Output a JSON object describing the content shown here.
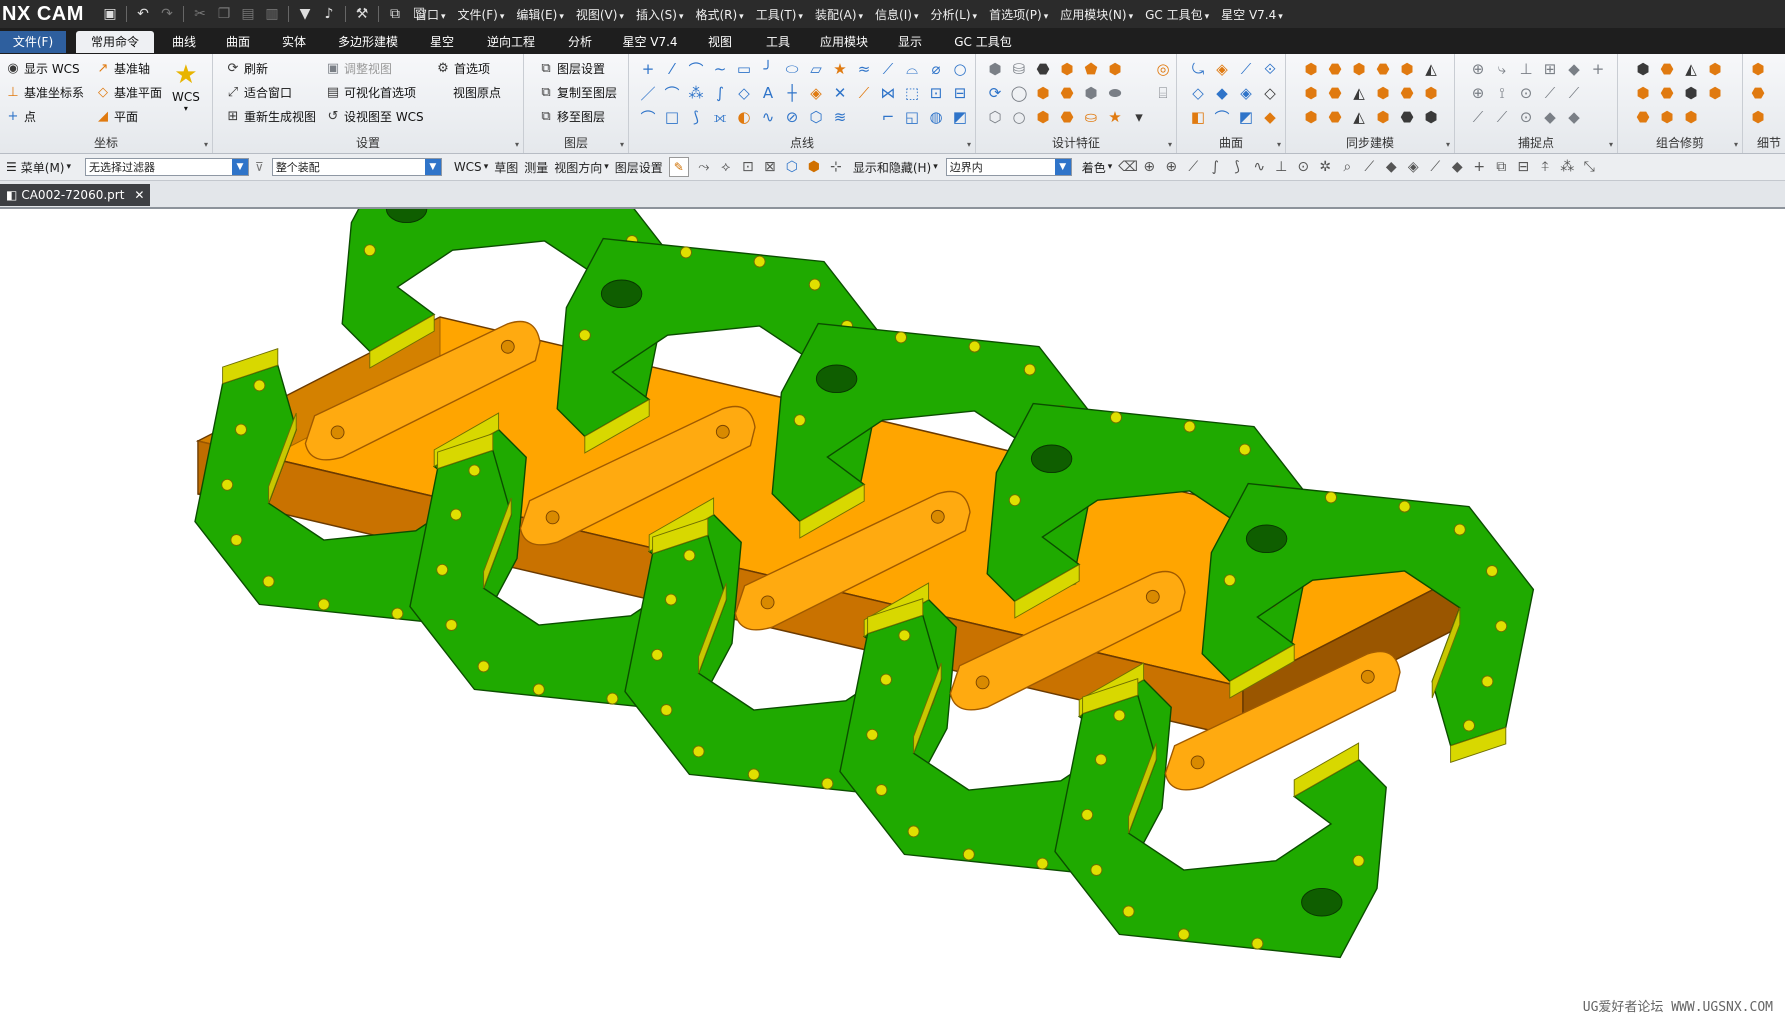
{
  "app": {
    "title": "NX CAM"
  },
  "quick_access": {
    "icons": [
      "save-icon",
      "undo-icon",
      "redo-icon",
      "cut-icon",
      "copy-icon",
      "paste-icon",
      "paste-special-icon",
      "command-finder-icon",
      "microphone-icon",
      "tools-icon",
      "window-icon"
    ]
  },
  "top_menu": {
    "items": [
      "窗口",
      "文件(F)",
      "编辑(E)",
      "视图(V)",
      "插入(S)",
      "格式(R)",
      "工具(T)",
      "装配(A)",
      "信息(I)",
      "分析(L)",
      "首选项(P)",
      "应用模块(N)",
      "GC 工具包",
      "星空 V7.4"
    ]
  },
  "tabs": {
    "file": "文件(F)",
    "items": [
      "常用命令",
      "曲线",
      "曲面",
      "实体",
      "多边形建模",
      "星空",
      "逆向工程",
      "分析",
      "星空 V7.4",
      "视图",
      "工具",
      "应用模块",
      "显示",
      "GC 工具包"
    ],
    "active_index": 0
  },
  "ribbon": {
    "coord": {
      "label": "坐标",
      "show_wcs": "显示 WCS",
      "datum_axis": "基准轴",
      "datum_csys": "基准坐标系",
      "datum_plane": "基准平面",
      "point": "点",
      "plane": "平面",
      "wcs": "WCS"
    },
    "settings": {
      "label": "设置",
      "refresh": "刷新",
      "adjust_view": "调整视图",
      "fit_window": "适合窗口",
      "visual_prefs": "可视化首选项",
      "regenerate_view": "重新生成视图",
      "set_view_wcs": "设视图至 WCS",
      "preferences": "首选项",
      "view_origin": "视图原点"
    },
    "layers": {
      "label": "图层",
      "layer_settings": "图层设置",
      "copy_to_layer": "复制至图层",
      "move_to_layer": "移至图层"
    },
    "groups": {
      "point_line": "点线",
      "design_feature": "设计特征",
      "surface": "曲面",
      "sync_modeling": "同步建模",
      "snap_point": "捕捉点",
      "combine_trim": "组合修剪",
      "detail": "细节"
    }
  },
  "selection_bar": {
    "menu": "菜单(M)",
    "filter": "无选择过滤器",
    "scope": "整个装配",
    "wcs": "WCS",
    "sketch": "草图",
    "measure": "测量",
    "view_direction": "视图方向",
    "layer_settings": "图层设置",
    "show_hide": "显示和隐藏(H)",
    "bound": "边界内",
    "shade": "着色"
  },
  "document": {
    "tab_name": "CA002-72060.prt"
  },
  "watermark": {
    "text": "UG爱好者论坛 WWW.UGSNX.COM"
  },
  "colors": {
    "base_top": "#ffa500",
    "base_side": "#c97200",
    "plate_top": "#1faa00",
    "plate_wall": "#d8d800",
    "hole": "#0f5e00"
  }
}
